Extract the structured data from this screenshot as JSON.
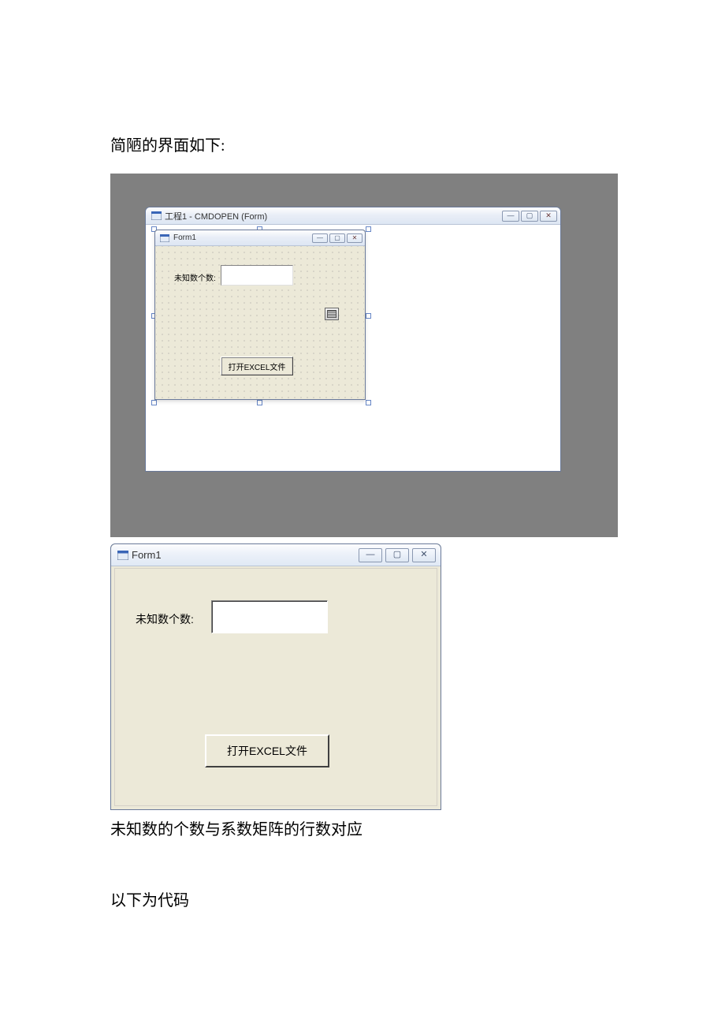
{
  "text": {
    "intro": "简陋的界面如下:",
    "note": "未知数的个数与系数矩阵的行数对应",
    "code_follows": "以下为代码"
  },
  "designer": {
    "project_title": "工程1 - CMDOPEN (Form)",
    "form_title": "Form1",
    "label_unknown_count": "未知数个数:",
    "open_excel_button": "打开EXCEL文件"
  },
  "runtime": {
    "form_title": "Form1",
    "label_unknown_count": "未知数个数:",
    "open_excel_button": "打开EXCEL文件"
  },
  "window_controls": {
    "minimize": "—",
    "maximize": "▢",
    "close": "✕"
  }
}
